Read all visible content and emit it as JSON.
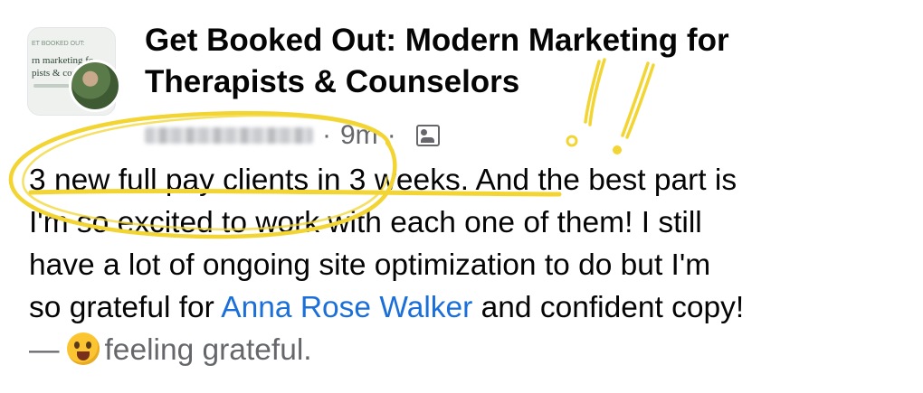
{
  "group": {
    "title": "Get Booked Out: Modern Marketing for Therapists & Counselors",
    "cover_text_1": "ET BOOKED OUT:",
    "cover_text_2": "rn marketing fo",
    "cover_text_3": "pists & counse"
  },
  "meta": {
    "separator": "·",
    "timestamp": "9m",
    "separator2": "·",
    "audience_icon": "group-audience-icon"
  },
  "post": {
    "highlighted_text": "3 new full pay clients in 3 weeks.",
    "line1_rest": " And the best part is",
    "line2": "I'm so excited to work with each one of them! I still",
    "line3": "have a lot of ongoing site optimization to do but I'm",
    "line4_before": "so grateful for ",
    "mention": "Anna Rose Walker",
    "line4_after": " and confident copy!",
    "feeling_dash": "—",
    "feeling_text": "feeling grateful."
  },
  "colors": {
    "mention": "#1b6fd8",
    "secondary_text": "#65676b",
    "annotation_yellow": "#f2d533"
  },
  "icons": {
    "emoji": "grateful-face-emoji"
  }
}
